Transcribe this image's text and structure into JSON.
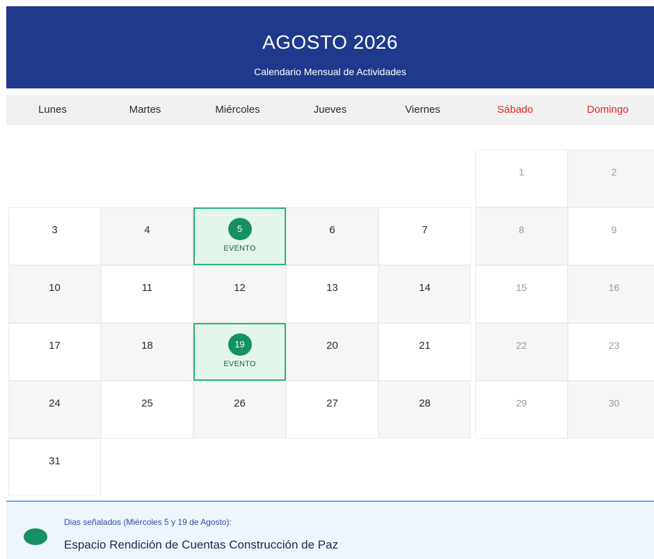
{
  "header": {
    "title": "AGOSTO 2026",
    "subtitle": "Calendario Mensual de Actividades"
  },
  "weekdays": [
    "Lunes",
    "Martes",
    "Miércoles",
    "Jueves",
    "Viernes",
    "Sábado",
    "Domingo"
  ],
  "days": {
    "d1": "1",
    "d2": "2",
    "d3": "3",
    "d4": "4",
    "d5": "5",
    "d6": "6",
    "d7": "7",
    "d8": "8",
    "d9": "9",
    "d10": "10",
    "d11": "11",
    "d12": "12",
    "d13": "13",
    "d14": "14",
    "d15": "15",
    "d16": "16",
    "d17": "17",
    "d18": "18",
    "d19": "19",
    "d20": "20",
    "d21": "21",
    "d22": "22",
    "d23": "23",
    "d24": "24",
    "d25": "25",
    "d26": "26",
    "d27": "27",
    "d28": "28",
    "d29": "29",
    "d30": "30",
    "d31": "31"
  },
  "event_label": "EVENTO",
  "legend": {
    "title": "Dias señalados (Miércoles 5 y 19 de Agosto):",
    "description": "Espacio Rendición de Cuentas Construcción de Paz"
  },
  "colors": {
    "header_bg": "#1f3a8c",
    "event_green": "#169163",
    "event_bg": "#e4f6ec",
    "weekend_red": "#e02424",
    "legend_bg": "#eef5fd"
  }
}
